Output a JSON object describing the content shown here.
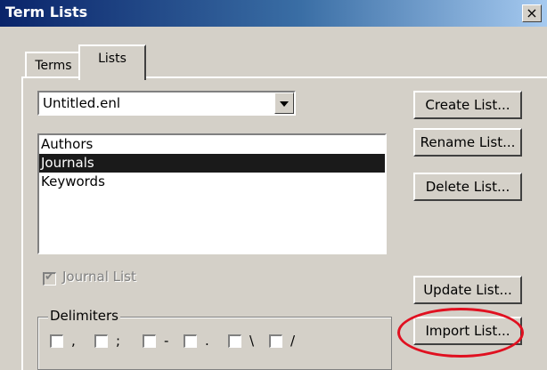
{
  "window": {
    "title": "Term Lists",
    "close_label": "×"
  },
  "tabs": [
    {
      "label": "Terms"
    },
    {
      "label": "Lists"
    }
  ],
  "library_combo": {
    "value": "Untitled.enl"
  },
  "lists": {
    "items": [
      {
        "label": "Authors",
        "selected": false
      },
      {
        "label": "Journals",
        "selected": true
      },
      {
        "label": "Keywords",
        "selected": false
      }
    ]
  },
  "buttons": {
    "create": "Create List...",
    "rename": "Rename List...",
    "delete": "Delete List...",
    "update": "Update List...",
    "import": "Import List..."
  },
  "journal_list": {
    "label": "Journal List",
    "checked": true,
    "enabled": false
  },
  "delimiters": {
    "label": "Delimiters",
    "chars": [
      ",",
      ";",
      "-",
      ".",
      "\\",
      "/"
    ]
  },
  "colors": {
    "highlight_oval": "#e01020",
    "selection": "#1a1a1a"
  }
}
